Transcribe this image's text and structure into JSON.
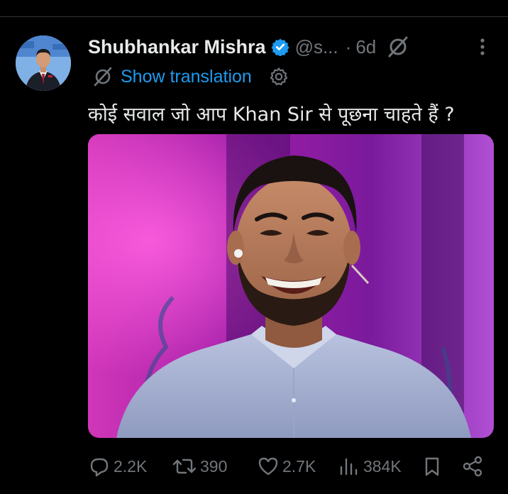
{
  "post": {
    "author_name": "Shubhankar Mishra",
    "handle": "@s...",
    "separator": "·",
    "time": "6d",
    "translation_label": "Show translation",
    "text": "कोई सवाल जो आप Khan Sir से पूछना चाहते हैं ?"
  },
  "actions": {
    "replies": "2.2K",
    "reposts": "390",
    "likes": "2.7K",
    "views": "384K"
  },
  "icons": [
    "verified-badge-icon",
    "grok-icon",
    "more-icon",
    "translate-icon",
    "gear-icon",
    "reply-icon",
    "repost-icon",
    "like-icon",
    "views-icon",
    "bookmark-icon",
    "share-icon"
  ],
  "colors": {
    "background": "#000000",
    "text": "#e7e9ea",
    "muted": "#71767b",
    "accent": "#1d9bf0"
  }
}
